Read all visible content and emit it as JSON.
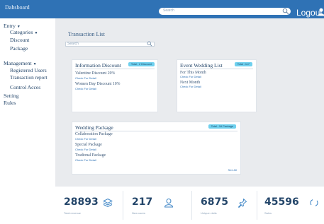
{
  "header": {
    "brand": "Dahsboard",
    "search_placeholder": "Search",
    "logout_label": "Logout"
  },
  "sidebar": {
    "items": [
      {
        "label": "Entry",
        "caret": "▼"
      },
      {
        "label": "Categories",
        "caret": "▼"
      },
      {
        "label": "Discount"
      },
      {
        "label": "Package"
      },
      {
        "label": "Management",
        "caret": "▼"
      },
      {
        "label": "Registered Users"
      },
      {
        "label": "Transaction report"
      },
      {
        "label": "Control Acces"
      },
      {
        "label": "Setting"
      },
      {
        "label": "Rules"
      }
    ]
  },
  "main": {
    "title": "Transaction List",
    "search_placeholder": "Search",
    "cards": {
      "discount": {
        "title": "Information Discount",
        "badge": "Total : 2 Discount",
        "items": [
          {
            "title": "Valentine Discount 20%",
            "link": "Check For Detail"
          },
          {
            "title": "Women Day Discount 10%",
            "link": "Check For Detail"
          }
        ]
      },
      "event": {
        "title": "Event Wedding List",
        "badge": "Total : 117",
        "items": [
          {
            "title": "For This Month",
            "link": "Check For Detail"
          },
          {
            "title": "Next Month",
            "link": "Check For Detail"
          }
        ]
      },
      "package": {
        "title": "Wedding Package",
        "badge": "Total : 16 Package",
        "items": [
          {
            "title": "Collaboration Package",
            "link": "Check For Detail"
          },
          {
            "title": "Special Package",
            "link": "Check For Detail"
          },
          {
            "title": "Tradional Package",
            "link": "Check For Detail"
          }
        ],
        "see_all": "See All"
      }
    }
  },
  "stats": [
    {
      "value": "28893",
      "label": "Total revenue",
      "icon": "layers-icon"
    },
    {
      "value": "217",
      "label": "New users",
      "icon": "user-icon"
    },
    {
      "value": "6875",
      "label": "Unique visits",
      "icon": "pin-icon"
    },
    {
      "value": "45596",
      "label": "Sales",
      "icon": "refresh-icon"
    }
  ],
  "colors": {
    "topbar": "#2f72b5",
    "badge": "#6fd0ee",
    "main_bg": "#e9ebee",
    "text": "#24466a"
  }
}
